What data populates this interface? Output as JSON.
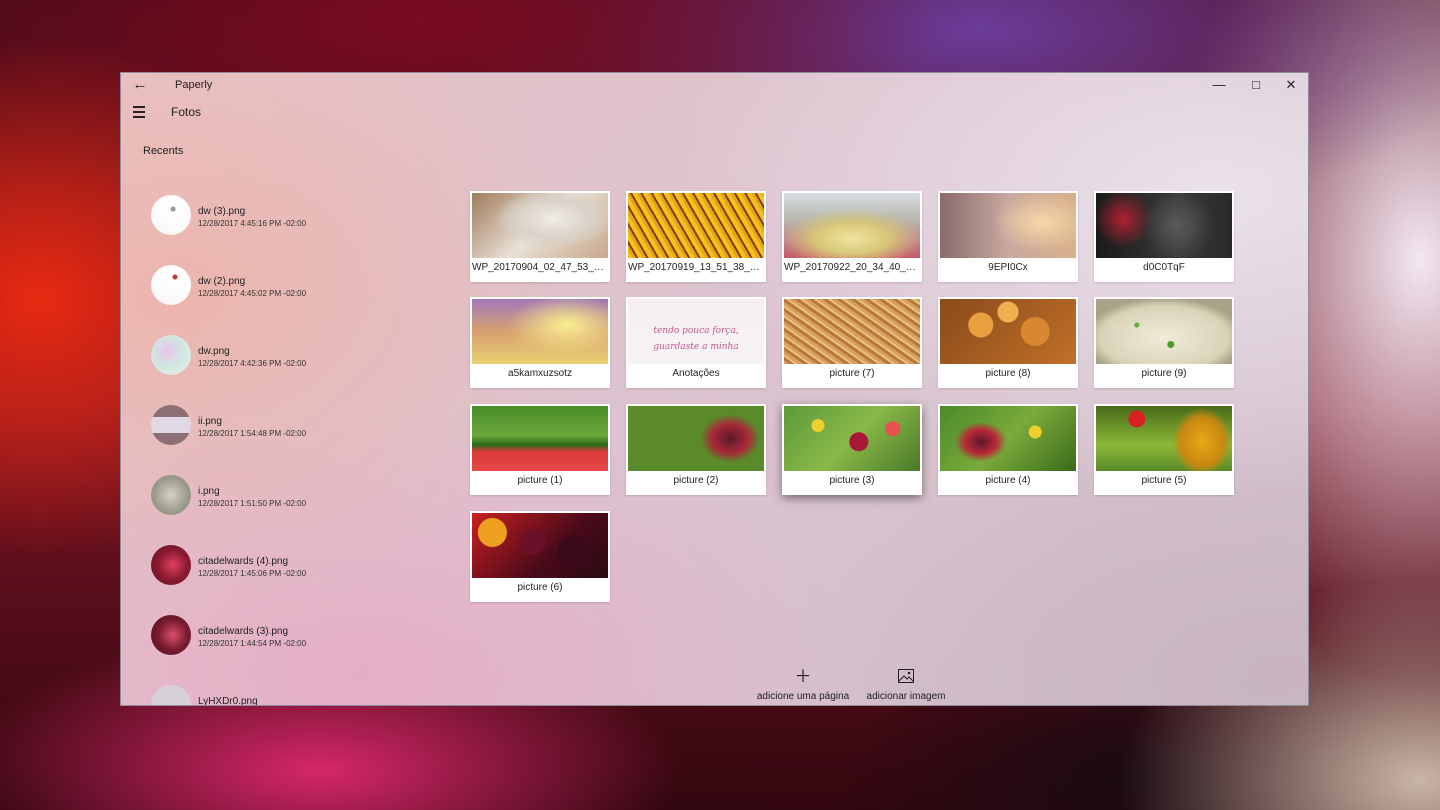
{
  "window": {
    "app_title": "Paperly",
    "page_title": "Fotos",
    "back_icon": "←",
    "minimize_icon": "—",
    "maximize_icon": "□",
    "close_icon": "✕"
  },
  "sidebar": {
    "section_title": "Recents",
    "items": [
      {
        "name": "dw (3).png",
        "date": "12/28/2017 4:45:16 PM -02:00"
      },
      {
        "name": "dw (2).png",
        "date": "12/28/2017 4:45:02 PM -02:00"
      },
      {
        "name": "dw.png",
        "date": "12/28/2017 4:42:36 PM -02:00"
      },
      {
        "name": "ii.png",
        "date": "12/28/2017 1:54:48 PM -02:00"
      },
      {
        "name": "i.png",
        "date": "12/28/2017 1:51:50 PM -02:00"
      },
      {
        "name": "citadelwards (4).png",
        "date": "12/28/2017 1:45:06 PM -02:00"
      },
      {
        "name": "citadelwards (3).png",
        "date": "12/28/2017 1:44:54 PM -02:00"
      },
      {
        "name": "LyHXDr0.png",
        "date": ""
      }
    ]
  },
  "grid": {
    "tiles": [
      {
        "label": "WP_20170904_02_47_53_Rich...",
        "selected": false
      },
      {
        "label": "WP_20170919_13_51_38_Raw...",
        "selected": false
      },
      {
        "label": "WP_20170922_20_34_40_Pro_LI",
        "selected": false
      },
      {
        "label": "9EPI0Cx",
        "selected": false
      },
      {
        "label": "d0C0TqF",
        "selected": false
      },
      {
        "label": "a5kamxuzsotz",
        "selected": false
      },
      {
        "label": "Anotações",
        "selected": false,
        "note_text": "tendo pouca força, guardaste a minha"
      },
      {
        "label": "picture (7)",
        "selected": false
      },
      {
        "label": "picture (8)",
        "selected": false
      },
      {
        "label": "picture (9)",
        "selected": false
      },
      {
        "label": "picture (1)",
        "selected": false
      },
      {
        "label": "picture (2)",
        "selected": false
      },
      {
        "label": "picture (3)",
        "selected": true
      },
      {
        "label": "picture (4)",
        "selected": false
      },
      {
        "label": "picture (5)",
        "selected": false
      },
      {
        "label": "picture (6)",
        "selected": false
      }
    ]
  },
  "commands": {
    "add_page": {
      "icon": "＋",
      "label": "adicione uma página"
    },
    "add_image": {
      "icon": "🖼",
      "label": "adicionar imagem"
    }
  }
}
